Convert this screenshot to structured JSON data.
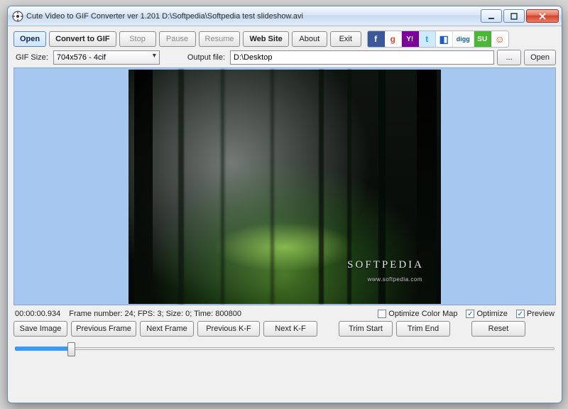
{
  "window": {
    "title": "Cute Video to GIF Converter ver 1.201   D:\\Softpedia\\Softpedia test slideshow.avi"
  },
  "toolbar": {
    "open": "Open",
    "convert": "Convert to GIF",
    "stop": "Stop",
    "pause": "Pause",
    "resume": "Resume",
    "website": "Web Site",
    "about": "About",
    "exit": "Exit"
  },
  "social": {
    "facebook": "f",
    "google": "g",
    "yahoo": "Y!",
    "twitter": "t",
    "delicious": "◧",
    "digg": "digg",
    "stumble": "SU",
    "reddit": "☺"
  },
  "gifsize": {
    "label": "GIF Size:",
    "value": "704x576 - 4cif"
  },
  "output": {
    "label": "Output file:",
    "value": "D:\\Desktop",
    "browse": "...",
    "open": "Open"
  },
  "watermark": {
    "brand": "SOFTPEDIA",
    "sub": "www.softpedia.com"
  },
  "status": {
    "time": "00:00:00.934",
    "frameinfo": "Frame number: 24; FPS: 3; Size: 0; Time: 800800"
  },
  "options": {
    "optimize_color_map_label": "Optimize Color Map",
    "optimize_color_map_checked": false,
    "optimize_label": "Optimize",
    "optimize_checked": true,
    "preview_label": "Preview",
    "preview_checked": true
  },
  "bottom": {
    "save_image": "Save Image",
    "previous_frame": "Previous Frame",
    "next_frame": "Next Frame",
    "previous_kf": "Previous K-F",
    "next_kf": "Next K-F",
    "trim_start": "Trim Start",
    "trim_end": "Trim End",
    "reset": "Reset"
  }
}
